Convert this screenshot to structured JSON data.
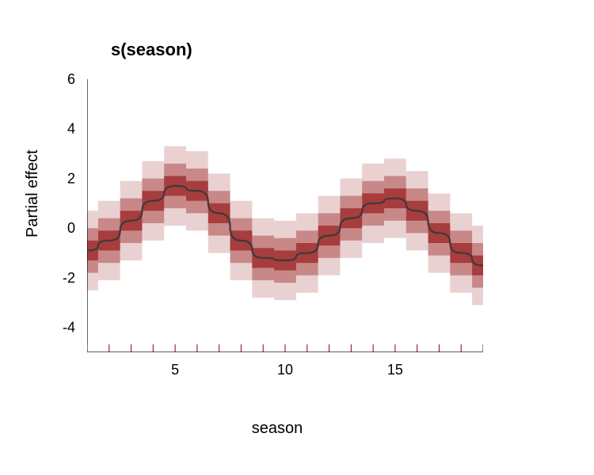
{
  "chart_data": {
    "type": "line",
    "title": "s(season)",
    "xlabel": "season",
    "ylabel": "Partial effect",
    "xlim": [
      1,
      19
    ],
    "ylim": [
      -5,
      6
    ],
    "x_ticks": [
      5,
      10,
      15
    ],
    "y_ticks": [
      -4,
      -2,
      0,
      2,
      4,
      6
    ],
    "rug_x": [
      1,
      2,
      3,
      4,
      5,
      6,
      7,
      8,
      9,
      10,
      11,
      12,
      13,
      14,
      15,
      16,
      17,
      18,
      19
    ],
    "x": [
      1,
      2,
      3,
      4,
      5,
      6,
      7,
      8,
      9,
      10,
      11,
      12,
      13,
      14,
      15,
      16,
      17,
      18,
      19
    ],
    "mean": [
      -0.9,
      -0.5,
      0.3,
      1.1,
      1.7,
      1.5,
      0.6,
      -0.5,
      -1.2,
      -1.3,
      -1.0,
      -0.3,
      0.4,
      1.0,
      1.2,
      0.7,
      -0.2,
      -1.0,
      -1.5
    ],
    "bands": [
      {
        "name": "inner",
        "color": "rgba(139,0,0,0.55)",
        "half_width": 0.4
      },
      {
        "name": "mid",
        "color": "rgba(139,0,0,0.35)",
        "half_width": 0.9
      },
      {
        "name": "outer",
        "color": "rgba(139,0,0,0.18)",
        "half_width": 1.6
      }
    ],
    "band_step_style": "rect"
  }
}
